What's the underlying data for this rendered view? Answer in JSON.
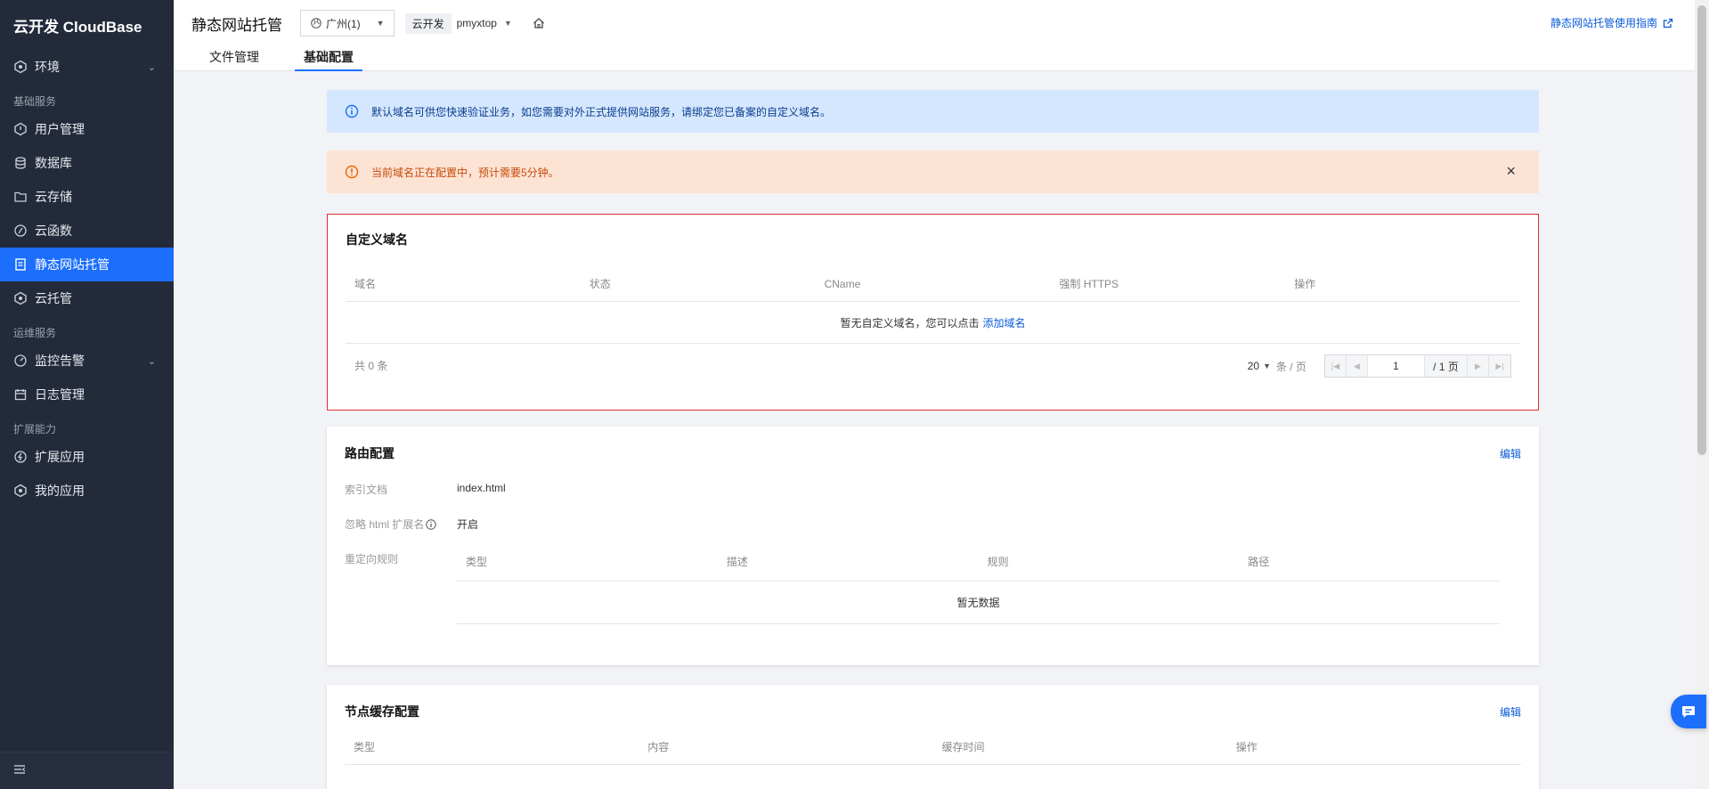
{
  "brand": "云开发 CloudBase",
  "sidebar": {
    "items": [
      {
        "label": "环境",
        "icon": "hexagon-icon",
        "expandable": true
      },
      {
        "group": "基础服务"
      },
      {
        "label": "用户管理",
        "icon": "user-icon"
      },
      {
        "label": "数据库",
        "icon": "database-icon"
      },
      {
        "label": "云存储",
        "icon": "folder-icon"
      },
      {
        "label": "云函数",
        "icon": "function-icon"
      },
      {
        "label": "静态网站托管",
        "icon": "document-icon",
        "active": true
      },
      {
        "label": "云托管",
        "icon": "hexagon-icon"
      },
      {
        "group": "运维服务"
      },
      {
        "label": "监控告警",
        "icon": "gauge-icon",
        "expandable": true
      },
      {
        "label": "日志管理",
        "icon": "calendar-icon"
      },
      {
        "group": "扩展能力"
      },
      {
        "label": "扩展应用",
        "icon": "bolt-icon"
      },
      {
        "label": "我的应用",
        "icon": "hexagon-icon"
      }
    ]
  },
  "header": {
    "title": "静态网站托管",
    "region": "广州(1)",
    "env_tag": "云开发",
    "env_name": "pmyxtop",
    "doc_link": "静态网站托管使用指南",
    "tabs": [
      {
        "label": "文件管理",
        "active": false
      },
      {
        "label": "基础配置",
        "active": true
      }
    ]
  },
  "alerts": {
    "info": "默认域名可供您快速验证业务，如您需要对外正式提供网站服务，请绑定您已备案的自定义域名。",
    "warning": "当前域名正在配置中，预计需要5分钟。"
  },
  "custom_domain": {
    "title": "自定义域名",
    "columns": [
      "域名",
      "状态",
      "CName",
      "强制 HTTPS",
      "操作"
    ],
    "empty_text": "暂无自定义域名，您可以点击",
    "empty_link": "添加域名",
    "total": "共 0 条",
    "page_size": "20",
    "per_page": "条 / 页",
    "page": "1",
    "page_total": "/ 1 页"
  },
  "route": {
    "title": "路由配置",
    "edit": "编辑",
    "index_label": "索引文档",
    "index_value": "index.html",
    "ignore_label": "忽略 html 扩展名",
    "ignore_value": "开启",
    "redirect_label": "重定向规则",
    "redirect_columns": [
      "类型",
      "描述",
      "规则",
      "路径"
    ],
    "redirect_empty": "暂无数据"
  },
  "cache": {
    "title": "节点缓存配置",
    "edit": "编辑",
    "columns": [
      "类型",
      "内容",
      "缓存时间",
      "操作"
    ]
  },
  "colors": {
    "sidebar_bg": "#232b3b",
    "accent": "#1c6efc",
    "info_bg": "#d5e7fe",
    "warn_bg": "#fde3d4",
    "highlight_border": "#e03030"
  }
}
